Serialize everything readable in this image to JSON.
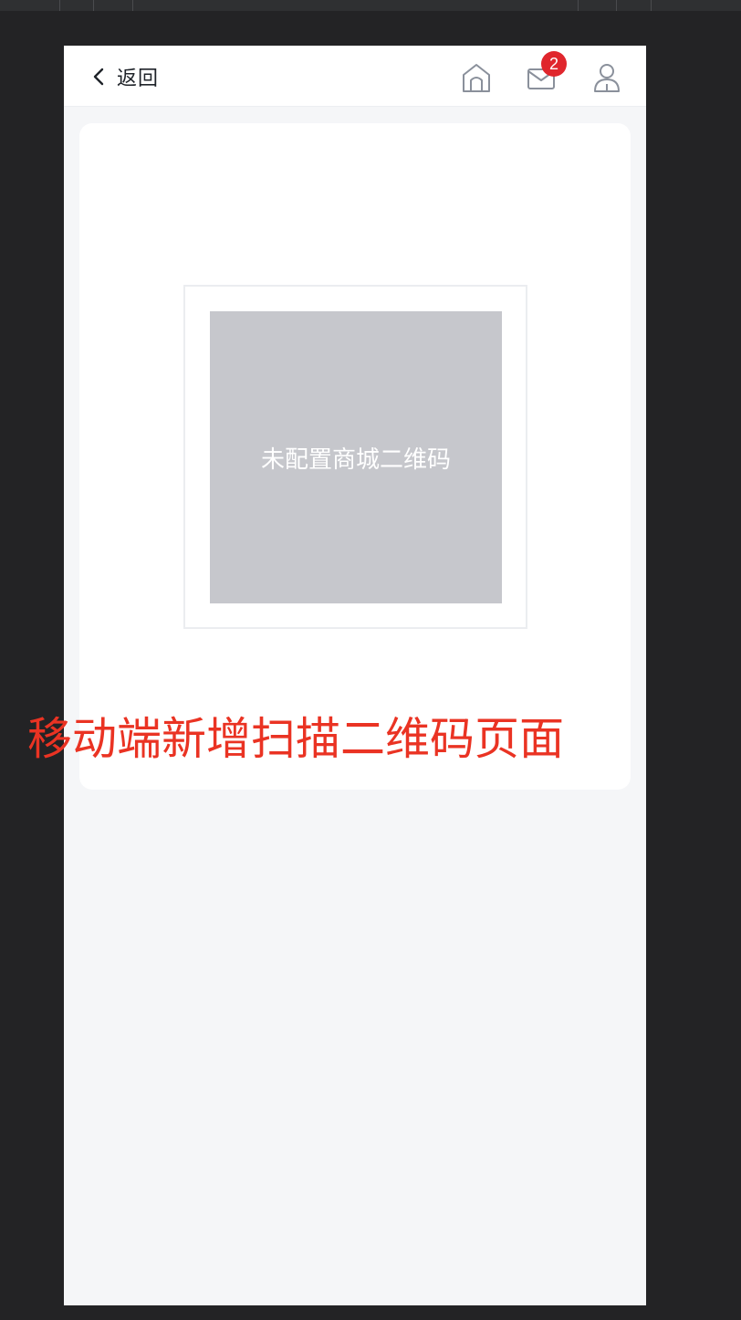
{
  "header": {
    "back_label": "返回",
    "icons": {
      "home": "home-icon",
      "mail": "mail-icon",
      "user": "user-icon"
    },
    "message_badge": "2"
  },
  "qr": {
    "placeholder_text": "未配置商城二维码"
  },
  "annotation": {
    "text": "移动端新增扫描二维码页面"
  },
  "colors": {
    "badge": "#e0262d",
    "annotation": "#ea3323",
    "placeholder_bg": "#c6c7cc",
    "page_bg": "#f5f6f8"
  }
}
